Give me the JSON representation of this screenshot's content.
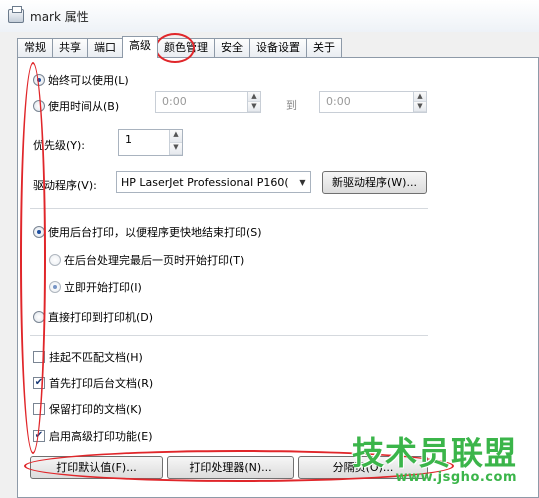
{
  "window": {
    "title": "mark 属性"
  },
  "tabs": [
    {
      "label": "常规"
    },
    {
      "label": "共享"
    },
    {
      "label": "端口"
    },
    {
      "label": "高级"
    },
    {
      "label": "颜色管理"
    },
    {
      "label": "安全"
    },
    {
      "label": "设备设置"
    },
    {
      "label": "关于"
    }
  ],
  "availability": {
    "always_label": "始终可以使用(L)",
    "time_label": "使用时间从(B)",
    "from_value": "0:00",
    "to_label": "到",
    "to_value": "0:00"
  },
  "priority": {
    "label": "优先级(Y):",
    "value": "1"
  },
  "driver": {
    "label": "驱动程序(V):",
    "selected": "HP LaserJet Professional P160(",
    "new_button": "新驱动程序(W)..."
  },
  "spool": {
    "use_spool_label": "使用后台打印，以便程序更快地结束打印(S)",
    "after_last_page": "在后台处理完最后一页时开始打印(T)",
    "immediately": "立即开始打印(I)",
    "direct_label": "直接打印到打印机(D)"
  },
  "options": {
    "hold_mismatched": "挂起不匹配文档(H)",
    "spooled_first": "首先打印后台文档(R)",
    "keep_printed": "保留打印的文档(K)",
    "advanced_features": "启用高级打印功能(E)"
  },
  "buttons": {
    "defaults": "打印默认值(F)...",
    "processor": "打印处理器(N)...",
    "separator": "分隔页(O)..."
  },
  "watermark": {
    "main": "技术员联盟",
    "sub": "www.jsgho.com"
  },
  "colors": {
    "annotation": "#e0262a",
    "watermark": "#3bb54a"
  }
}
